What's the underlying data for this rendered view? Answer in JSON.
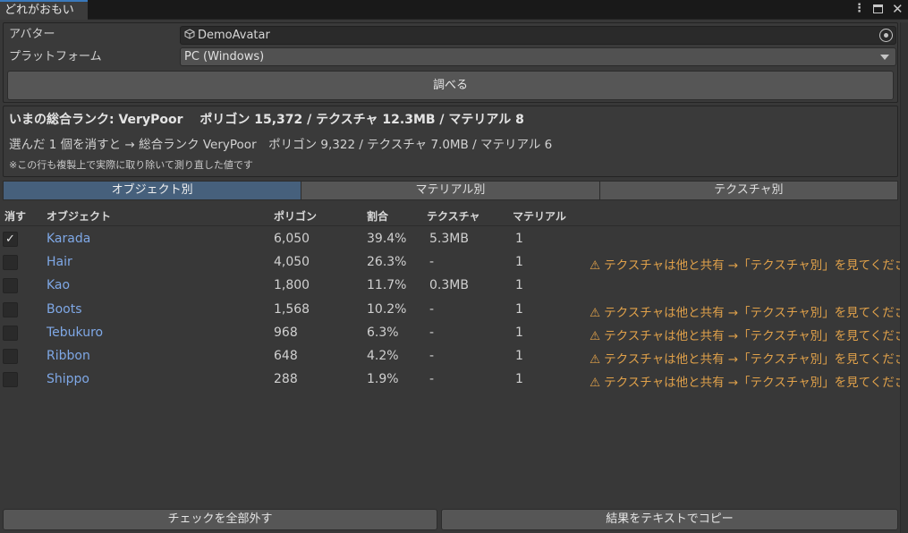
{
  "window": {
    "tab_title": "どれがおもい"
  },
  "form": {
    "avatar_label": "アバター",
    "avatar_value": "DemoAvatar",
    "platform_label": "プラットフォーム",
    "platform_value": "PC (Windows)",
    "inspect_button": "調べる"
  },
  "summary": {
    "current": "いまの総合ランク: VeryPoor　 ポリゴン 15,372 / テクスチャ 12.3MB / マテリアル 8",
    "after_remove": "選んだ 1 個を消すと → 総合ランク VeryPoor　ポリゴン 9,322 / テクスチャ 7.0MB / マテリアル 6",
    "note": "※この行も複製上で実際に取り除いて測り直した値です"
  },
  "tabs": [
    "オブジェクト別",
    "マテリアル別",
    "テクスチャ別"
  ],
  "table": {
    "headers": {
      "remove": "消す",
      "object": "オブジェクト",
      "polygons": "ポリゴン",
      "ratio": "割合",
      "texture": "テクスチャ",
      "material": "マテリアル"
    },
    "rows": [
      {
        "checked": true,
        "name": "Karada",
        "polygons": "6,050",
        "ratio": "39.4%",
        "texture": "5.3MB",
        "material": "1",
        "warning": ""
      },
      {
        "checked": false,
        "name": "Hair",
        "polygons": "4,050",
        "ratio": "26.3%",
        "texture": "-",
        "material": "1",
        "warning": "テクスチャは他と共有 →「テクスチャ別」を見てください"
      },
      {
        "checked": false,
        "name": "Kao",
        "polygons": "1,800",
        "ratio": "11.7%",
        "texture": "0.3MB",
        "material": "1",
        "warning": ""
      },
      {
        "checked": false,
        "name": "Boots",
        "polygons": "1,568",
        "ratio": "10.2%",
        "texture": "-",
        "material": "1",
        "warning": "テクスチャは他と共有 →「テクスチャ別」を見てください"
      },
      {
        "checked": false,
        "name": "Tebukuro",
        "polygons": "968",
        "ratio": "6.3%",
        "texture": "-",
        "material": "1",
        "warning": "テクスチャは他と共有 →「テクスチャ別」を見てください"
      },
      {
        "checked": false,
        "name": "Ribbon",
        "polygons": "648",
        "ratio": "4.2%",
        "texture": "-",
        "material": "1",
        "warning": "テクスチャは他と共有 →「テクスチャ別」を見てください"
      },
      {
        "checked": false,
        "name": "Shippo",
        "polygons": "288",
        "ratio": "1.9%",
        "texture": "-",
        "material": "1",
        "warning": "テクスチャは他と共有 →「テクスチャ別」を見てください"
      }
    ]
  },
  "footer": {
    "uncheck_all": "チェックを全部外す",
    "copy_result": "結果をテキストでコピー"
  },
  "colors": {
    "accent_tab": "#46607c",
    "object_link": "#7fa8e6",
    "warning": "#e0a14a"
  }
}
